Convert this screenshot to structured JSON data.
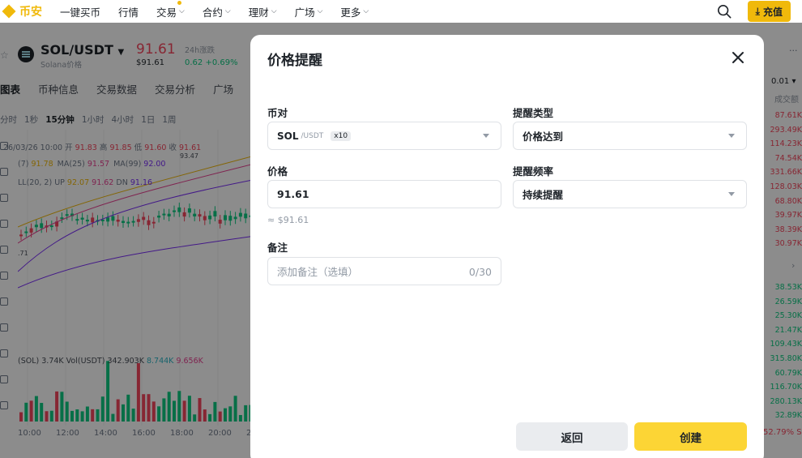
{
  "nav": {
    "logo_text": "币安",
    "items": [
      {
        "label": "一键买币",
        "chevron": false
      },
      {
        "label": "行情",
        "chevron": false
      },
      {
        "label": "交易",
        "chevron": true
      },
      {
        "label": "合约",
        "chevron": true
      },
      {
        "label": "理财",
        "chevron": true
      },
      {
        "label": "广场",
        "chevron": true
      },
      {
        "label": "更多",
        "chevron": true
      }
    ],
    "deposit_label": "充值"
  },
  "ticker": {
    "pair": "SOL/USDT",
    "sub": "Solana价格",
    "price": "91.61",
    "price_usd": "$91.61",
    "change_label": "24h涨跌",
    "change_value": "0.62 +0.69%"
  },
  "subtabs": [
    "图表",
    "币种信息",
    "交易数据",
    "交易分析",
    "广场"
  ],
  "intervals": [
    "分时",
    "1秒",
    "15分钟",
    "1小时",
    "4小时",
    "1日",
    "1周"
  ],
  "chart_overlay": {
    "ohlc": {
      "date": "26/03/26 10:00",
      "open_label": "开",
      "open": "91.83",
      "high_label": "高",
      "high": "91.85",
      "low_label": "低",
      "low": "91.60",
      "close_label": "收",
      "close": "91.61"
    },
    "ma": [
      {
        "label": "(7)",
        "value": "91.78",
        "color": "#f0b90b"
      },
      {
        "label": "MA(25)",
        "value": "91.57",
        "color": "#e84393"
      },
      {
        "label": "MA(99)",
        "value": "92.00",
        "color": "#7b2ff7"
      }
    ],
    "bb": {
      "label": "LL(20, 2)",
      "up_label": "UP",
      "up": "92.07",
      "mb": "91.62",
      "dn_label": "DN",
      "dn": "91.16"
    },
    "high_marker": "93.47",
    "low_marker": ".71",
    "vol": {
      "label": "(SOL)",
      "value": "3.74K",
      "usdt_label": "Vol(USDT)",
      "usdt": "342.903K",
      "v1": "8.744K",
      "v2": "9.656K"
    },
    "time_axis": [
      "10:00",
      "12:00",
      "14:00",
      "16:00",
      "18:00",
      "20:00",
      "2"
    ]
  },
  "orderbook": {
    "precision": "0.01",
    "header": "成交额",
    "asks": [
      "87.61K",
      "293.49K",
      "114.23K",
      "74.54K",
      "331.66K",
      "128.03K",
      "68.80K",
      "39.97K",
      "38.39K",
      "30.97K"
    ],
    "bids": [
      "38.53K",
      "26.59K",
      "25.30K",
      "21.47K",
      "109.43K",
      "315.80K",
      "60.79K",
      "116.70K",
      "280.13K",
      "32.89K"
    ],
    "bottom": "52.79% S"
  },
  "modal": {
    "title": "价格提醒",
    "pair_label": "币对",
    "pair_main": "SOL",
    "pair_quote": "/USDT",
    "pair_leverage": "x10",
    "type_label": "提醒类型",
    "type_value": "价格达到",
    "price_label": "价格",
    "price_value": "91.61",
    "price_approx": "≈ $91.61",
    "freq_label": "提醒频率",
    "freq_value": "持续提醒",
    "note_label": "备注",
    "note_placeholder": "添加备注（选填）",
    "note_count": "0/30",
    "back_label": "返回",
    "create_label": "创建"
  }
}
